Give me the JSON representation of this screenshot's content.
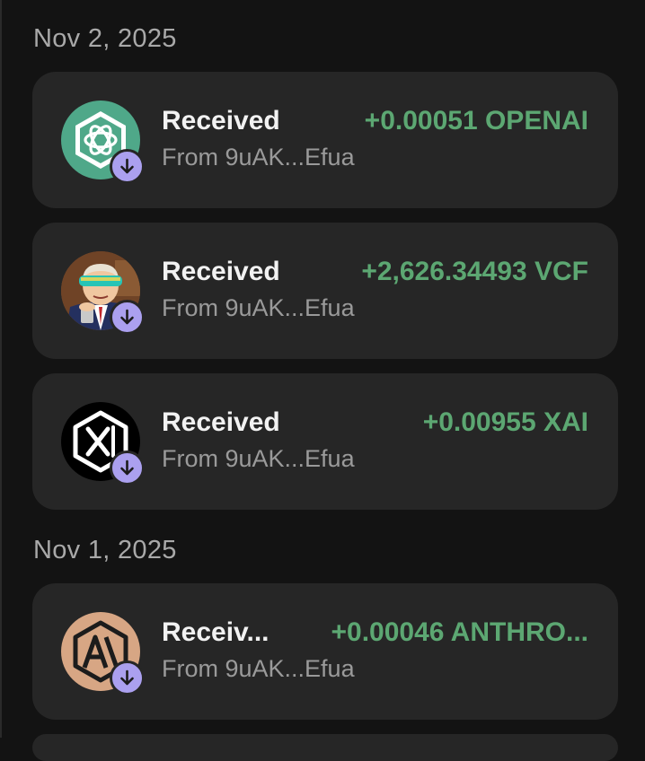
{
  "groups": [
    {
      "date": "Nov 2, 2025",
      "items": [
        {
          "title": "Received",
          "subtitle": "From 9uAK...Efua",
          "amount": "+0.00051 OPENAI",
          "icon": "openai-logo-icon"
        },
        {
          "title": "Received",
          "subtitle": "From 9uAK...Efua",
          "amount": "+2,626.34493 VCF",
          "icon": "cartoon-man-avatar"
        },
        {
          "title": "Received",
          "subtitle": "From 9uAK...Efua",
          "amount": "+0.00955 XAI",
          "icon": "xai-logo-icon"
        }
      ]
    },
    {
      "date": "Nov 1, 2025",
      "items": [
        {
          "title": "Receiv...",
          "subtitle": "From 9uAK...Efua",
          "amount": "+0.00046 ANTHRO...",
          "icon": "anthropic-logo-icon"
        }
      ]
    }
  ],
  "colors": {
    "background": "#131313",
    "card": "#262626",
    "positive_amount": "#5ca772",
    "badge": "#aba0ef"
  },
  "badge_icon": "arrow-down-icon"
}
